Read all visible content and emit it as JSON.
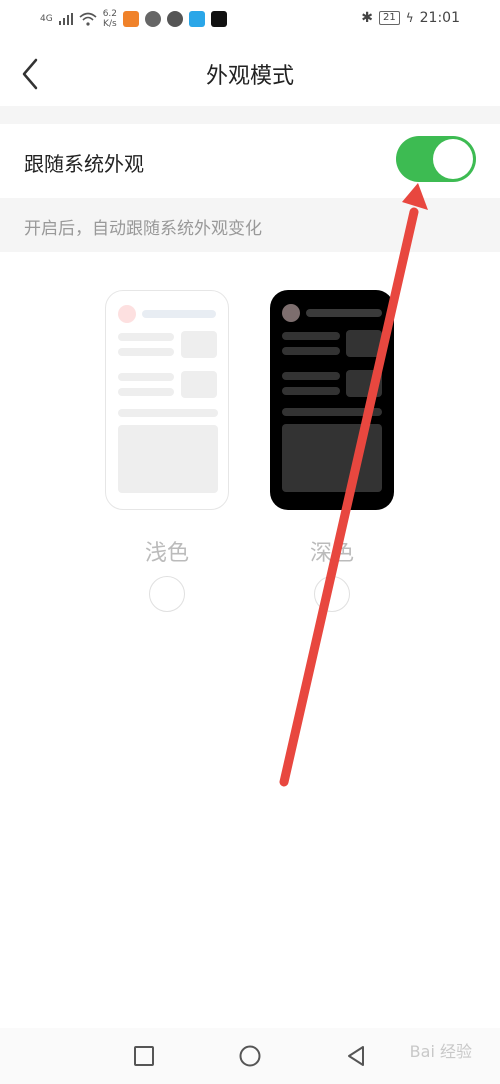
{
  "status_bar": {
    "network": "4G",
    "speed_value": "6.2",
    "speed_unit": "K/s",
    "battery": "21",
    "time": "21:01"
  },
  "header": {
    "title": "外观模式"
  },
  "follow_system": {
    "label": "跟随系统外观",
    "enabled": true,
    "hint": "开启后，自动跟随系统外观变化"
  },
  "themes": [
    {
      "label": "浅色"
    },
    {
      "label": "深色"
    }
  ],
  "colors": {
    "toggle_on": "#3dbb52",
    "annotation": "#e8473f"
  },
  "watermark": "Bai 经验"
}
